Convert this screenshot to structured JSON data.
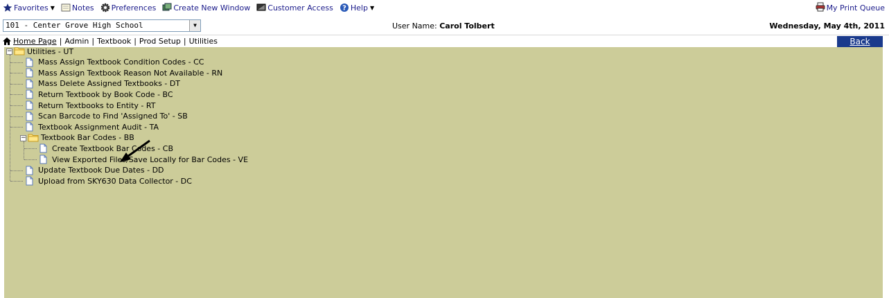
{
  "toolbar": {
    "favorites": "Favorites",
    "notes": "Notes",
    "preferences": "Preferences",
    "new_window": "Create New Window",
    "customer_access": "Customer Access",
    "help": "Help",
    "print_queue": "My Print Queue"
  },
  "info": {
    "school": "101 - Center Grove High School",
    "user_label": "User Name:",
    "user_name": "Carol Tolbert",
    "date": "Wednesday, May 4th, 2011"
  },
  "breadcrumb": {
    "home": "Home Page",
    "items": [
      "Admin",
      "Textbook",
      "Prod Setup",
      "Utilities"
    ],
    "back": "Back"
  },
  "tree": {
    "root": "Utilities - UT",
    "items": [
      "Mass Assign Textbook Condition Codes - CC",
      "Mass Assign Textbook Reason Not Available - RN",
      "Mass Delete Assigned Textbooks - DT",
      "Return Textbook by Book Code - BC",
      "Return Textbooks to Entity - RT",
      "Scan Barcode to Find 'Assigned To' - SB",
      "Textbook Assignment Audit - TA"
    ],
    "subfolder": "Textbook Bar Codes - BB",
    "subitems": [
      "Create Textbook Bar Codes - CB",
      "View Exported Files/Save Locally for Bar Codes - VE"
    ],
    "items_after": [
      "Update Textbook Due Dates - DD",
      "Upload from SKY630 Data Collector - DC"
    ]
  },
  "colors": {
    "tree_background": "#cccc99",
    "back_button": "#1a3a8c",
    "toolbar_link": "#1a1a8a"
  }
}
